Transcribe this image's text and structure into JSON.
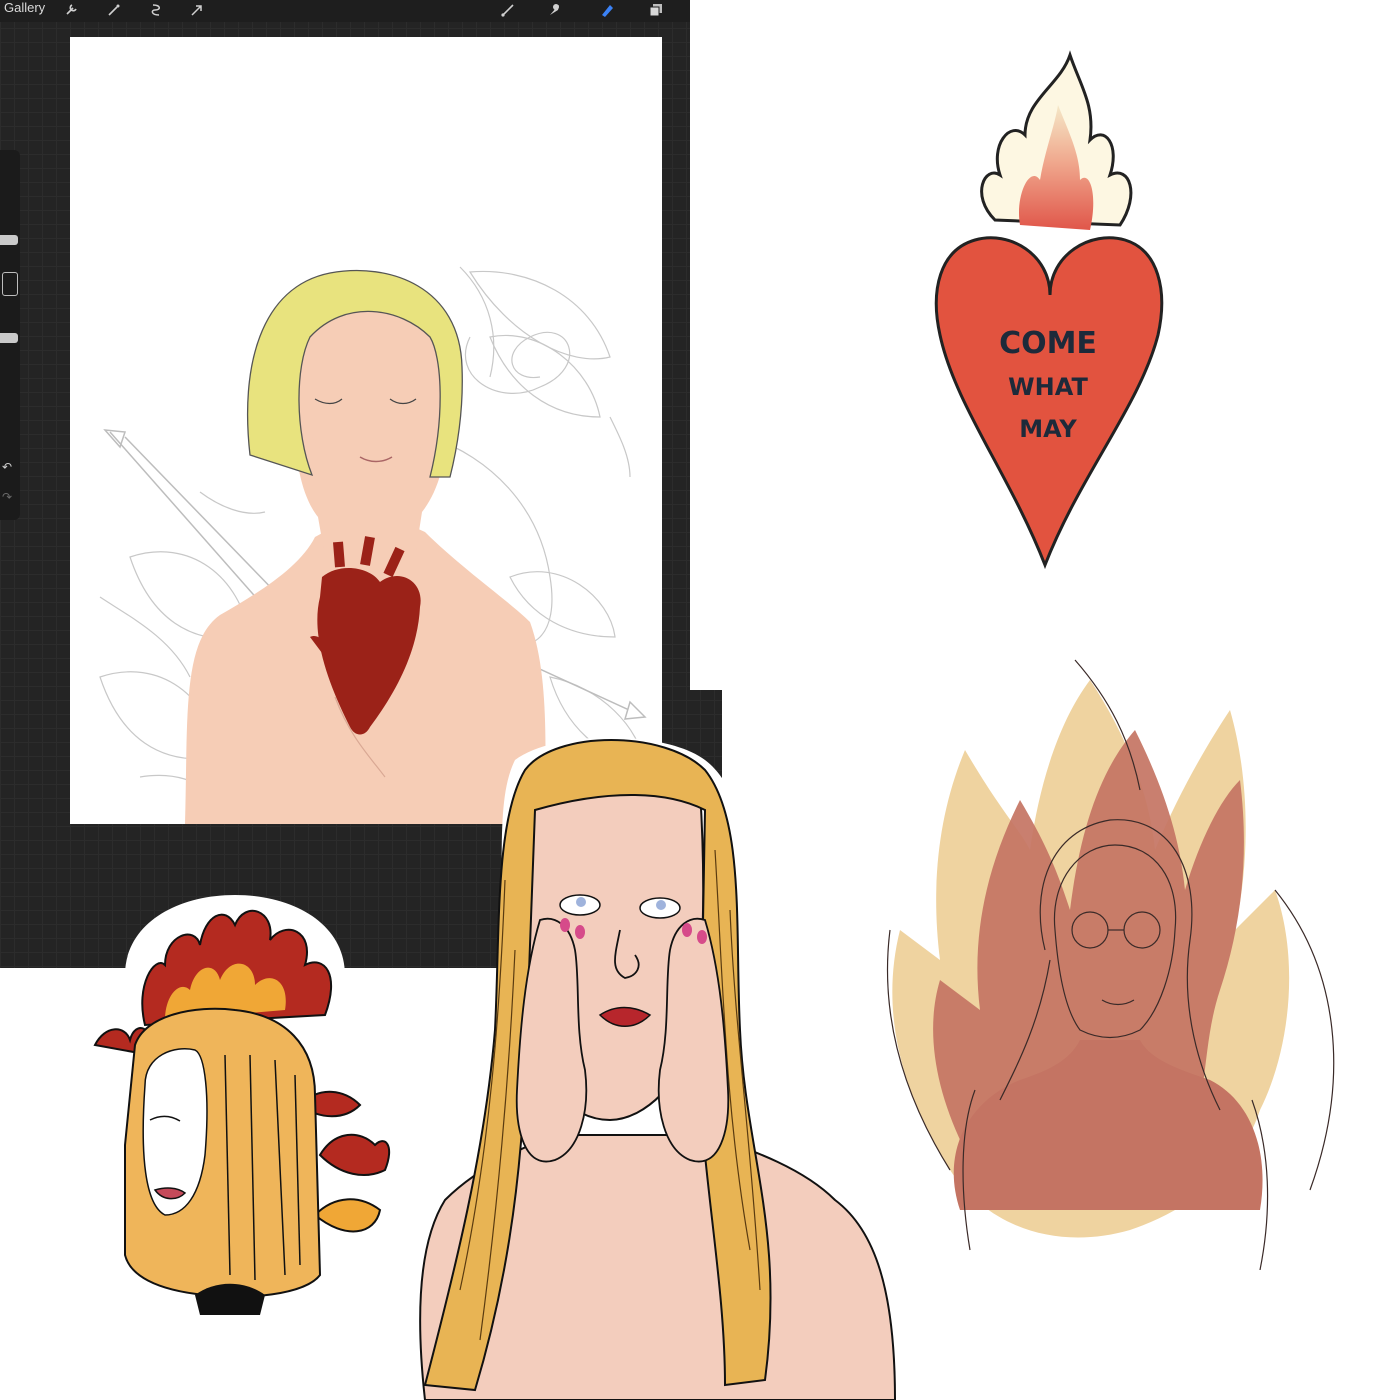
{
  "app": {
    "gallery_label": "Gallery",
    "toolbar_icons": [
      "wrench-icon",
      "magic-wand-icon",
      "selection-icon",
      "move-arrow-icon",
      "brush-icon",
      "smudge-icon",
      "eraser-icon",
      "layers-icon"
    ]
  },
  "stickers": {
    "heart": {
      "text_line1": "COME",
      "text_line2": "WHAT",
      "text_line3": "MAY"
    }
  },
  "colors": {
    "app_background": "#242424",
    "heart_red": "#e2533f",
    "flame_beige": "#efd3a0",
    "flame_brown": "#c47463",
    "hair_yellow": "#e8e07a",
    "hair_gold": "#e8b454",
    "skin": "#f4cfbf",
    "anatomical_heart": "#9b2218"
  }
}
